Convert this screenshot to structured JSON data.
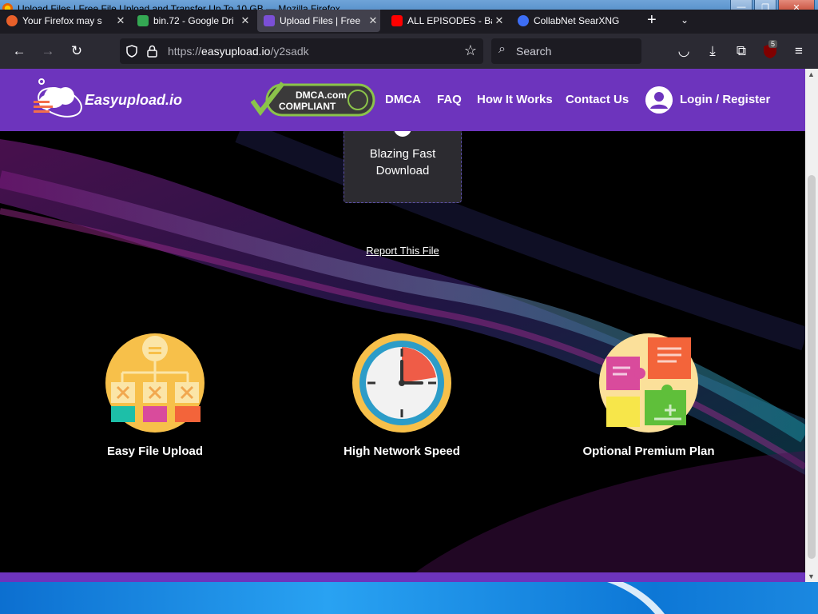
{
  "window": {
    "title": "Upload Files | Free File Upload and Transfer Up To 10 GB — Mozilla Firefox",
    "minimize_glyph": "—",
    "restore_glyph": "❐",
    "close_glyph": "✕"
  },
  "tabs": [
    {
      "label": "Your Firefox may s",
      "favicon": "firefox-icon",
      "color": "#e8602a",
      "active": false
    },
    {
      "label": "bin.72 - Google Dri",
      "favicon": "google-drive-icon",
      "color": "#34a853",
      "active": false
    },
    {
      "label": "Upload Files | Free",
      "favicon": "easyupload-icon",
      "color": "#7b4fd6",
      "active": true
    },
    {
      "label": "ALL EPISODES - Ba",
      "favicon": "youtube-icon",
      "color": "#ff0000",
      "active": false
    },
    {
      "label": "CollabNet SearXNG",
      "favicon": "search-icon",
      "color": "#3d6ef5",
      "active": false
    }
  ],
  "tab_close_glyph": "✕",
  "newtab_glyph": "+",
  "tablist_glyph": "⌄",
  "navbar": {
    "back_glyph": "←",
    "forward_glyph": "→",
    "reload_glyph": "↻",
    "url_prefix": "https://",
    "url_host": "easyupload.io",
    "url_path": "/y2sadk",
    "search_placeholder": "Search",
    "search_glyph": "⌕",
    "bookmark_glyph": "☆",
    "pocket_glyph": "◡",
    "downloads_glyph": "⤓",
    "extensions_glyph": "⧉",
    "menu_glyph": "≡",
    "ublock_badge": "5"
  },
  "site": {
    "brand": "Easyupload.io",
    "dmca_line1": "DMCA.com",
    "dmca_line2": "COMPLIANT",
    "menu": [
      "DMCA",
      "FAQ",
      "How It Works",
      "Contact Us"
    ],
    "login": "Login / Register"
  },
  "content": {
    "card_line1": "Blazing Fast",
    "card_line2": "Download",
    "report_link": "Report This File",
    "features": [
      {
        "label": "Easy File Upload",
        "icon": "file-hierarchy-icon"
      },
      {
        "label": "High Network Speed",
        "icon": "clock-icon"
      },
      {
        "label": "Optional Premium Plan",
        "icon": "puzzle-icon"
      }
    ]
  },
  "colors": {
    "header_purple": "#6d34bd",
    "browser_dark": "#1c1b22",
    "navbar_dark": "#2b2a33"
  }
}
